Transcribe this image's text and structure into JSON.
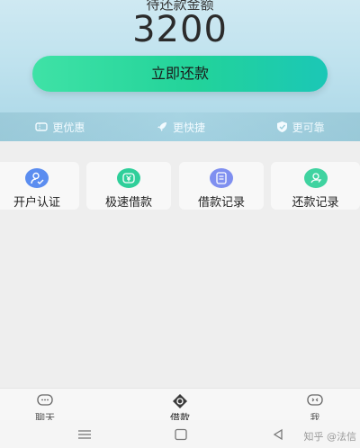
{
  "header": {
    "amount_label": "待还款金额",
    "amount_value": "3200",
    "repay_button": "立即还款"
  },
  "features": [
    {
      "icon": "ticket-icon",
      "label": "更优惠"
    },
    {
      "icon": "rocket-icon",
      "label": "更快捷"
    },
    {
      "icon": "shield-check-icon",
      "label": "更可靠"
    }
  ],
  "entries": [
    {
      "icon": "user-verify-icon",
      "label": "开户认证",
      "color": "#5b8df0"
    },
    {
      "icon": "yen-icon",
      "label": "极速借款",
      "color": "#2fcf9a"
    },
    {
      "icon": "document-list-icon",
      "label": "借款记录",
      "color": "#7f8ff0"
    },
    {
      "icon": "repay-record-icon",
      "label": "还款记录",
      "color": "#3fd3a0"
    }
  ],
  "tabs": [
    {
      "icon": "chat-icon",
      "label": "聊天"
    },
    {
      "icon": "loan-icon",
      "label": "借款"
    },
    {
      "icon": "profile-icon",
      "label": "我"
    }
  ],
  "watermark": "知乎 @法信"
}
